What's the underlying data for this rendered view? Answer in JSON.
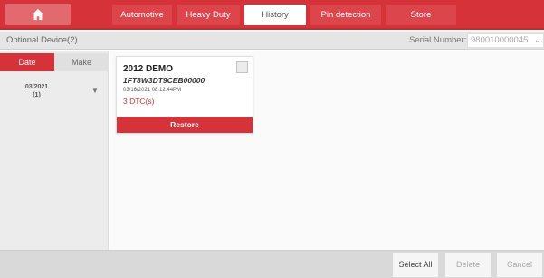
{
  "nav": {
    "home_icon": "home-icon",
    "tabs": [
      {
        "label": "Automotive",
        "active": false
      },
      {
        "label": "Heavy Duty",
        "active": false
      },
      {
        "label": "History",
        "active": true
      },
      {
        "label": "Pin detection",
        "active": false
      },
      {
        "label": "Store",
        "active": false
      }
    ]
  },
  "subheader": {
    "title": "Optional Device(2)",
    "serial_label": "Serial Number:",
    "serial_value": "980010000045"
  },
  "sidebar": {
    "tabs": [
      "Date",
      "Make"
    ],
    "date_groups": [
      {
        "date": "03/2021",
        "count": "(1)"
      }
    ]
  },
  "records": [
    {
      "title": "2012 DEMO",
      "vin": "1FT8W3DT9CEB00000",
      "timestamp": "03/16/2021 08:12:44PM",
      "dtc": "3 DTC(s)",
      "action": "Restore",
      "checked": false
    }
  ],
  "footer": {
    "select_all": "Select All",
    "delete": "Delete",
    "cancel": "Cancel"
  },
  "colors": {
    "accent": "#d6323a",
    "tab_active_bg": "#ffffff",
    "disabled_text": "#a8a8a8"
  }
}
